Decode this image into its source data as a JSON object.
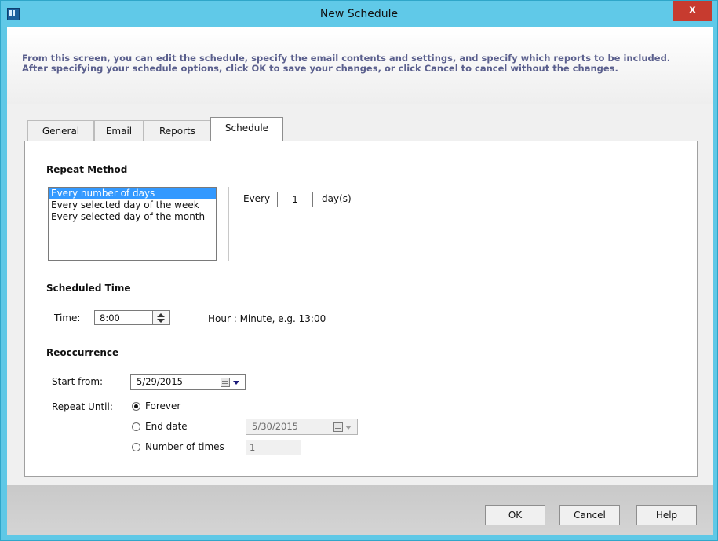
{
  "window": {
    "title": "New Schedule",
    "close_label": "x"
  },
  "header": {
    "description": "From this screen, you can edit the schedule, specify the email contents and settings, and specify which reports to be included. After specifying your schedule options, click OK to save your changes, or click Cancel to cancel without the changes."
  },
  "tabs": [
    {
      "label": "General",
      "active": false
    },
    {
      "label": "Email",
      "active": false
    },
    {
      "label": "Reports",
      "active": false
    },
    {
      "label": "Schedule",
      "active": true
    }
  ],
  "repeat_method": {
    "title": "Repeat Method",
    "options": [
      "Every number of days",
      "Every selected day of the week",
      "Every selected day of the month"
    ],
    "selected": "Every number of days",
    "every_label": "Every",
    "every_value": "1",
    "unit_label": "day(s)"
  },
  "scheduled_time": {
    "title": "Scheduled Time",
    "time_label": "Time:",
    "time_value": "8:00",
    "hint": "Hour : Minute, e.g. 13:00"
  },
  "reoccurrence": {
    "title": "Reoccurrence",
    "start_label": "Start from:",
    "start_value": "5/29/2015",
    "repeat_until_label": "Repeat Until:",
    "forever_label": "Forever",
    "end_date_label": "End date",
    "end_date_value": "5/30/2015",
    "number_of_times_label": "Number of times",
    "number_of_times_value": "1",
    "selected_option": "Forever"
  },
  "buttons": {
    "ok": "OK",
    "cancel": "Cancel",
    "help": "Help"
  },
  "colors": {
    "title_bar": "#60c9e8",
    "close_button": "#c73b2f",
    "header_text": "#5a5f8d",
    "selection": "#3399ff"
  }
}
